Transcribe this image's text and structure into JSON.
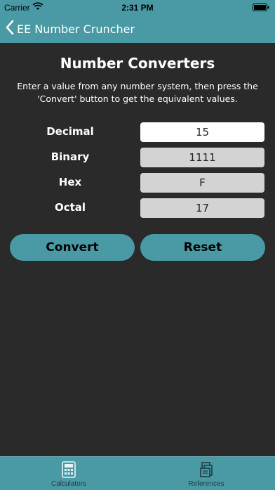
{
  "status_bar": {
    "carrier": "Carrier",
    "time": "2:31 PM"
  },
  "nav": {
    "back_title": "EE Number Cruncher"
  },
  "page": {
    "heading": "Number Converters",
    "instructions": "Enter a value from any number system, then press the 'Convert' button to get the equivalent values."
  },
  "converters": [
    {
      "label": "Decimal",
      "value": "15"
    },
    {
      "label": "Binary",
      "value": "1111"
    },
    {
      "label": "Hex",
      "value": "F"
    },
    {
      "label": "Octal",
      "value": "17"
    }
  ],
  "buttons": {
    "convert": "Convert",
    "reset": "Reset"
  },
  "tabs": [
    {
      "label": "Calculators",
      "icon": "calculator-icon"
    },
    {
      "label": "References",
      "icon": "books-icon"
    }
  ],
  "colors": {
    "accent": "#4a9aa5",
    "background": "#2a2a2a",
    "field_active": "#ffffff",
    "field_readonly": "#d3d3d3"
  }
}
